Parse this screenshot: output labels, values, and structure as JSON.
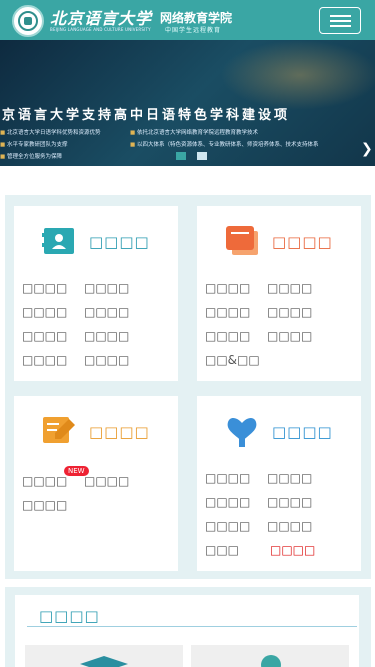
{
  "header": {
    "university_cn": "北京语言大学",
    "university_en": "BEIJING LANGUAGE AND CULTURE UNIVERSITY",
    "school_name": "网络教育学院",
    "school_sub": "中国学生远程教育"
  },
  "banner": {
    "title": "京语言大学支持高中日语特色学科建设项",
    "lines": [
      "北京语言大学日语学科优势和资源优势",
      "依托北京语言大学网络教育学院远程教育教学技术",
      "水平专家教研团队为支撑",
      "以四大体系（特色资源体系、专业教研体系、师资培养体系、技术支持体系",
      "管理全方位服务为保障"
    ]
  },
  "sections": [
    {
      "heading": "□□□□",
      "color": "#2a9bb0",
      "icon": "contact-card-icon",
      "links": [
        "□□□□",
        "□□□□",
        "□□□□",
        "□□□□",
        "□□□□",
        "□□□□",
        "□□□□",
        "□□□□"
      ]
    },
    {
      "heading": "□□□□",
      "color": "#e8643a",
      "icon": "folder-stack-icon",
      "links": [
        "□□□□",
        "□□□□",
        "□□□□",
        "□□□□",
        "□□□□",
        "□□□□",
        "□□&□□"
      ]
    },
    {
      "heading": "□□□□",
      "color": "#e89a2a",
      "icon": "edit-document-icon",
      "new_badge": "NEW",
      "links": [
        "□□□□",
        "□□□□",
        "□□□□"
      ]
    },
    {
      "heading": "□□□□",
      "color": "#2a8fd0",
      "icon": "care-hands-icon",
      "links": [
        "□□□□",
        "□□□□",
        "□□□□",
        "□□□□",
        "□□□□",
        "□□□□",
        "□□□",
        "□□□□"
      ]
    }
  ],
  "bottom": {
    "heading": "□□□□"
  },
  "colors": {
    "header_bg": "#3aa6a4",
    "section_bg": "#e4f1f3",
    "highlight_red": "#d11111"
  }
}
